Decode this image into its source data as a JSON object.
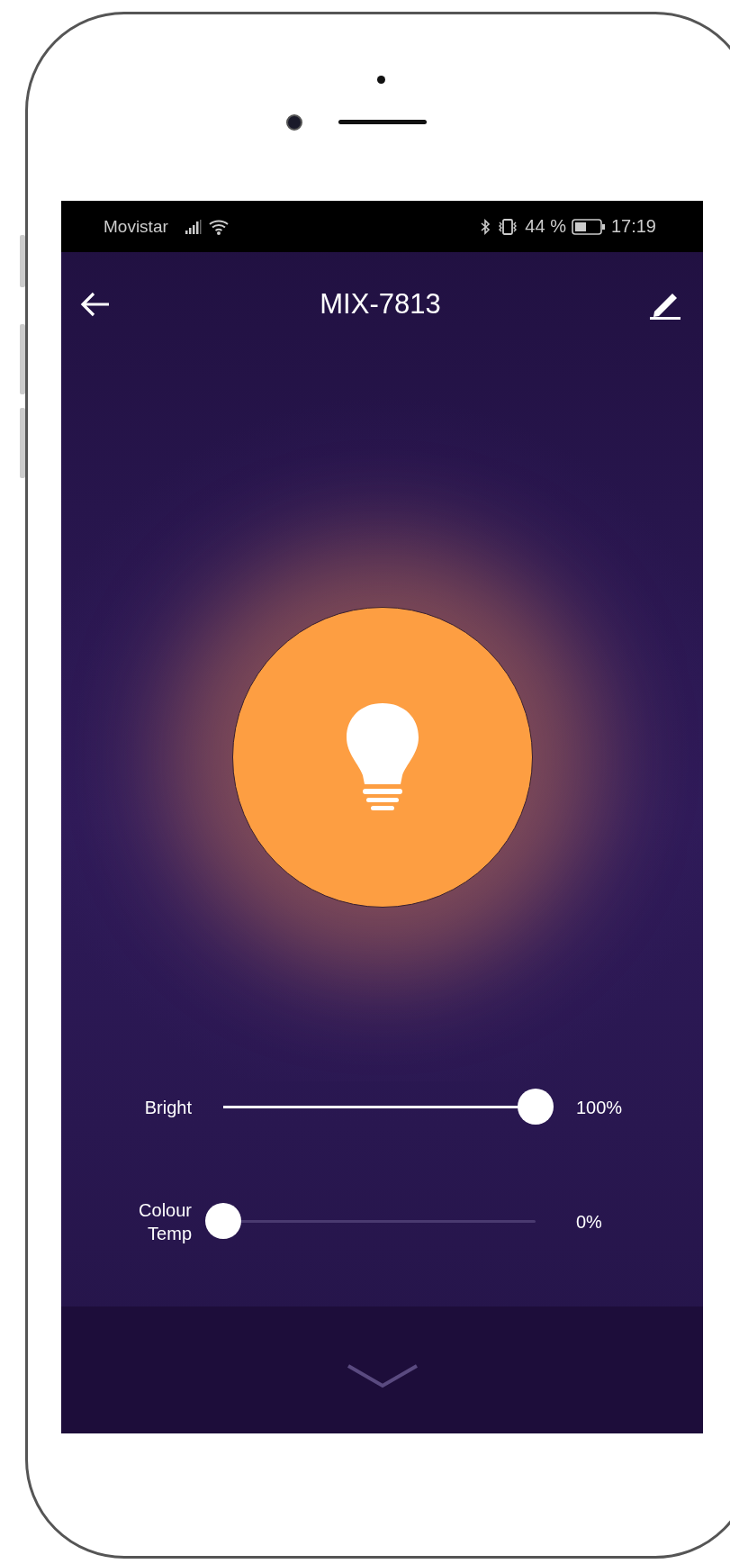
{
  "status_bar": {
    "carrier": "Movistar",
    "battery": "44 %",
    "time": "17:19"
  },
  "app_bar": {
    "title": "MIX-7813"
  },
  "light": {
    "on": true
  },
  "sliders": [
    {
      "label": "Bright",
      "level": 1,
      "reading": "100%"
    },
    {
      "label": "Colour Temp",
      "level": 0,
      "reading": "0%"
    }
  ]
}
